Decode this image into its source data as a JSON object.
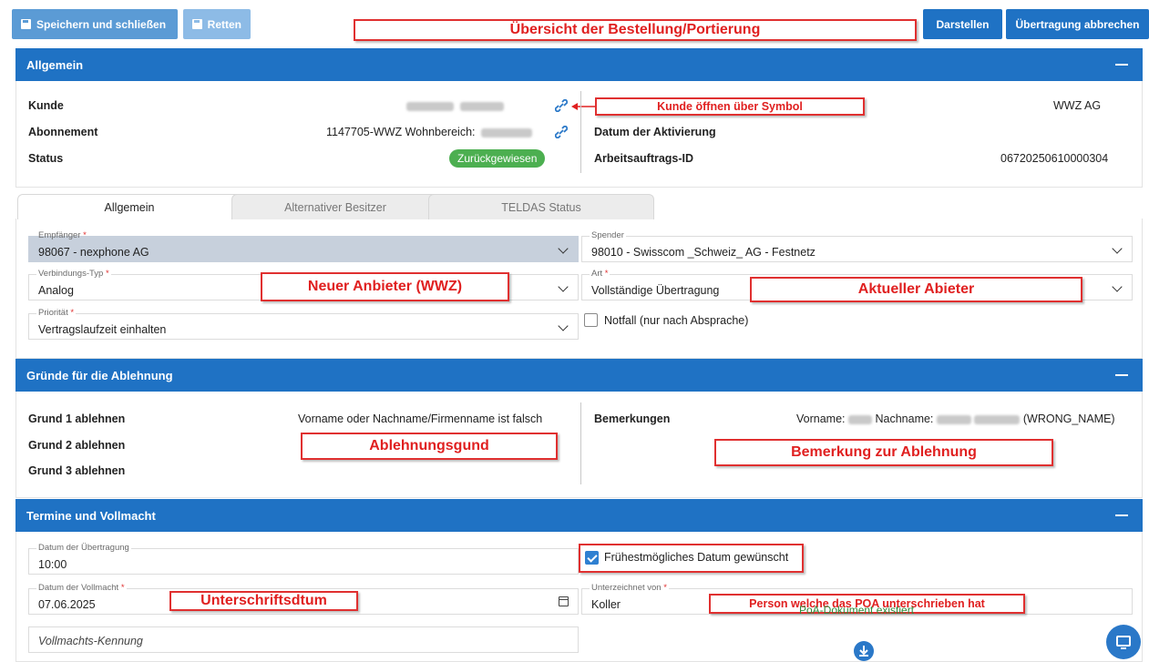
{
  "toolbar": {
    "save_close": "Speichern und schließen",
    "save": "Retten",
    "display": "Darstellen",
    "cancel_transfer": "Übertragung abbrechen"
  },
  "annotations": {
    "overview": "Übersicht der Bestellung/Portierung",
    "open_customer": "Kunde öffnen über Symbol",
    "new_provider": "Neuer Anbieter (WWZ)",
    "current_provider": "Aktueller Abieter",
    "rejection_reason": "Ablehnungsgund",
    "rejection_remark": "Bemerkung zur Ablehnung",
    "signature_date": "Unterschriftsdtum",
    "poa_signer": "Person welche das POA unterschrieben hat"
  },
  "general": {
    "header": "Allgemein",
    "customer_label": "Kunde",
    "subscription_label": "Abonnement",
    "subscription_value": "1147705-WWZ Wohnbereich:",
    "status_label": "Status",
    "status_value": "Zurückgewiesen",
    "company_value": "WWZ AG",
    "activation_label": "Datum der Aktivierung",
    "work_order_label": "Arbeitsauftrags-ID",
    "work_order_value": "06720250610000304"
  },
  "tabs": [
    {
      "label": "Allgemein"
    },
    {
      "label": "Alternativer Besitzer"
    },
    {
      "label": "TELDAS Status"
    }
  ],
  "form": {
    "recipient_label": "Empfänger",
    "recipient_value": "98067 - nexphone AG",
    "donor_label": "Spender",
    "donor_value": "98010 - Swisscom _Schweiz_ AG - Festnetz",
    "connection_label": "Verbindungs-Typ",
    "connection_value": "Analog",
    "type_label": "Art",
    "type_value": "Vollständige Übertragung",
    "priority_label": "Priorität",
    "priority_value": "Vertragslaufzeit einhalten",
    "emergency_label": "Notfall (nur nach Absprache)",
    "required_mark": "*"
  },
  "rejection": {
    "header": "Gründe für die Ablehnung",
    "reason1_label": "Grund 1 ablehnen",
    "reason1_value": "Vorname oder Nachname/Firmenname ist falsch",
    "reason2_label": "Grund 2 ablehnen",
    "reason3_label": "Grund 3 ablehnen",
    "remarks_label": "Bemerkungen",
    "remarks_prefix": "Vorname:",
    "remarks_mid": "Nachname:",
    "remarks_suffix": "(WRONG_NAME)"
  },
  "dates": {
    "header": "Termine und Vollmacht",
    "transfer_date_label": "Datum der Übertragung",
    "transfer_date_value": "10:00",
    "earliest_label": "Frühestmögliches Datum gewünscht",
    "poa_date_label": "Datum der Vollmacht",
    "poa_date_value": "07.06.2025",
    "signed_by_label": "Unterzeichnet von",
    "signed_by_value": "Koller",
    "poa_id_placeholder": "Vollmachts-Kennung",
    "poa_exists": "PoA-Dokument existiert"
  }
}
